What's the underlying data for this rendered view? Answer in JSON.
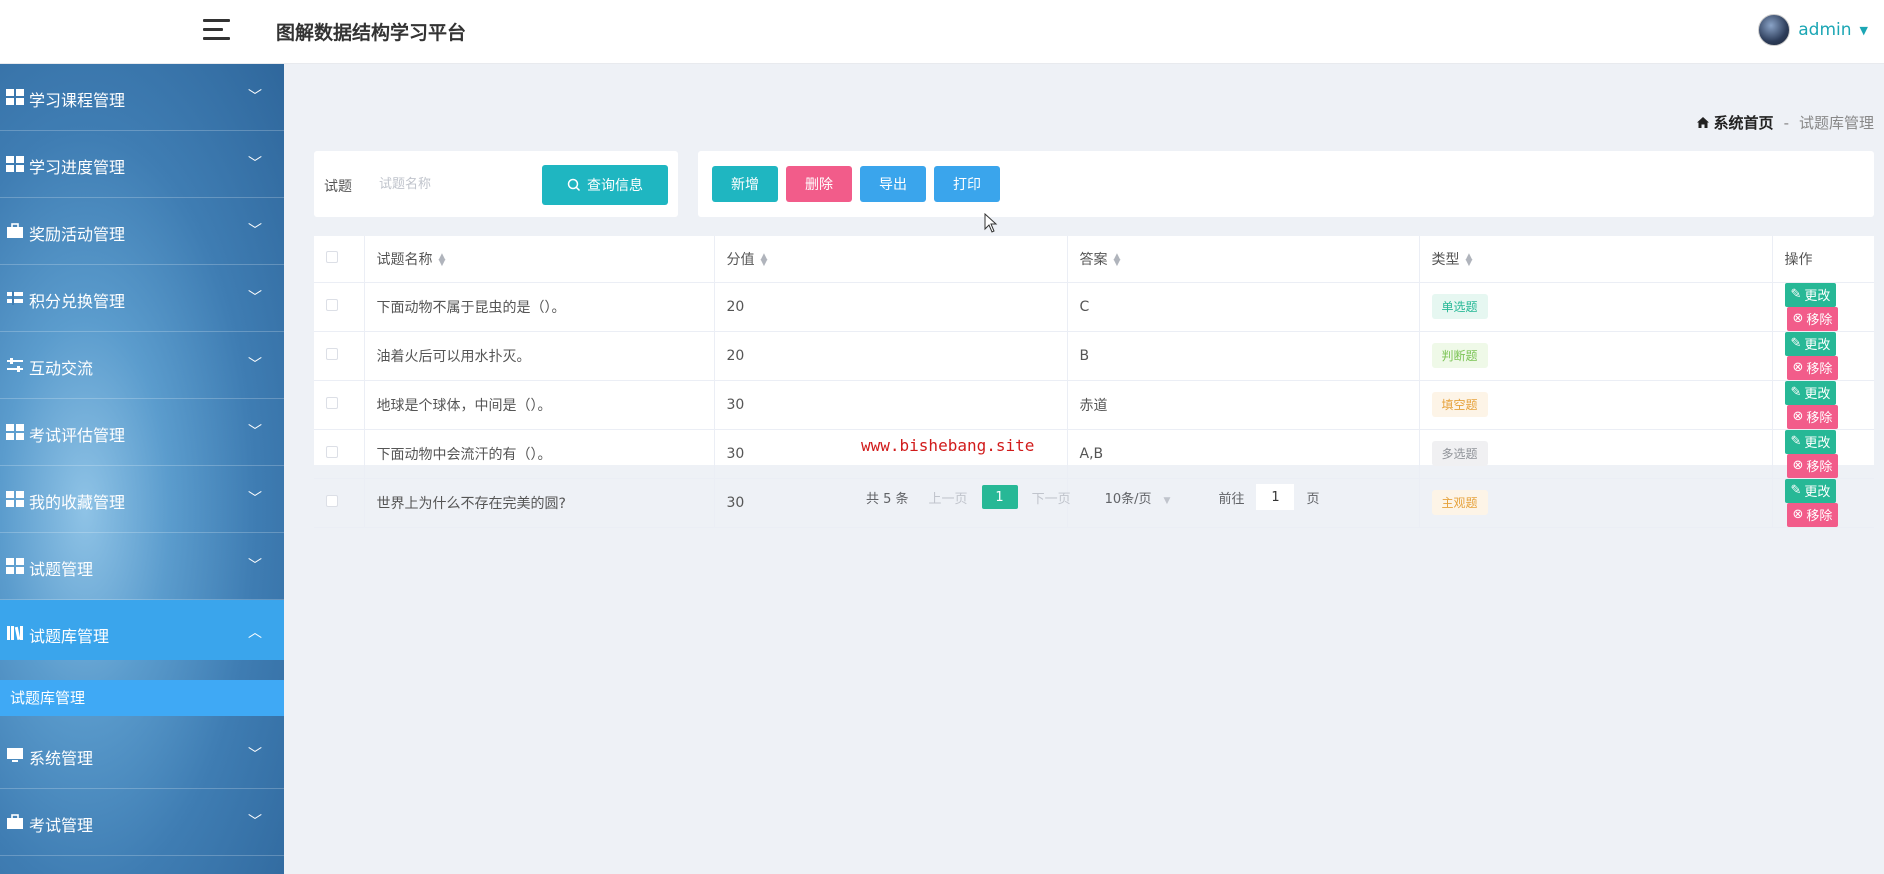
{
  "header": {
    "title": "图解数据结构学习平台",
    "user": "admin"
  },
  "sidebar": {
    "items": [
      {
        "label": "学习课程管理",
        "icon": "grid-icon"
      },
      {
        "label": "学习进度管理",
        "icon": "grid-icon"
      },
      {
        "label": "奖励活动管理",
        "icon": "briefcase-icon"
      },
      {
        "label": "积分兑换管理",
        "icon": "exchange-icon"
      },
      {
        "label": "互动交流",
        "icon": "sliders-icon"
      },
      {
        "label": "考试评估管理",
        "icon": "grid-icon"
      },
      {
        "label": "我的收藏管理",
        "icon": "grid-icon"
      },
      {
        "label": "试题管理",
        "icon": "grid-icon"
      },
      {
        "label": "试题库管理",
        "icon": "book-icon",
        "active": true
      },
      {
        "label": "系统管理",
        "icon": "monitor-icon"
      },
      {
        "label": "考试管理",
        "icon": "briefcase-icon"
      }
    ],
    "active_sub": "试题库管理"
  },
  "breadcrumb": {
    "home": "系统首页",
    "separator": "-",
    "current": "试题库管理"
  },
  "search": {
    "label": "试题",
    "placeholder": "试题名称",
    "button": "查询信息"
  },
  "actions": {
    "add": "新增",
    "delete": "删除",
    "export": "导出",
    "print": "打印"
  },
  "table": {
    "columns": [
      "试题名称",
      "分值",
      "答案",
      "类型",
      "操作"
    ],
    "rows": [
      {
        "name": "下面动物不属于昆虫的是（）。",
        "score": "20",
        "answer": "C",
        "type": "单选题"
      },
      {
        "name": "油着火后可以用水扑灭。",
        "score": "20",
        "answer": "B",
        "type": "判断题"
      },
      {
        "name": "地球是个球体，中间是（）。",
        "score": "30",
        "answer": "赤道",
        "type": "填空题"
      },
      {
        "name": "下面动物中会流汗的有（）。",
        "score": "30",
        "answer": "A,B",
        "type": "多选题"
      },
      {
        "name": "世界上为什么不存在完美的圆?",
        "score": "30",
        "answer": "",
        "type": "主观题"
      }
    ],
    "edit_label": "更改",
    "delete_label": "移除"
  },
  "watermark": "www.bishebang.site",
  "pagination": {
    "total": "共 5 条",
    "prev": "上一页",
    "page": "1",
    "next": "下一页",
    "size": "10条/页",
    "goto_label": "前往",
    "goto_value": "1",
    "page_unit": "页"
  },
  "colors": {
    "accent": "#1fb6c1",
    "add": "#1fb6c1",
    "delete": "#f25c8a",
    "export": "#3aa5ec",
    "print": "#3aa5ec",
    "edit": "#27b896"
  }
}
